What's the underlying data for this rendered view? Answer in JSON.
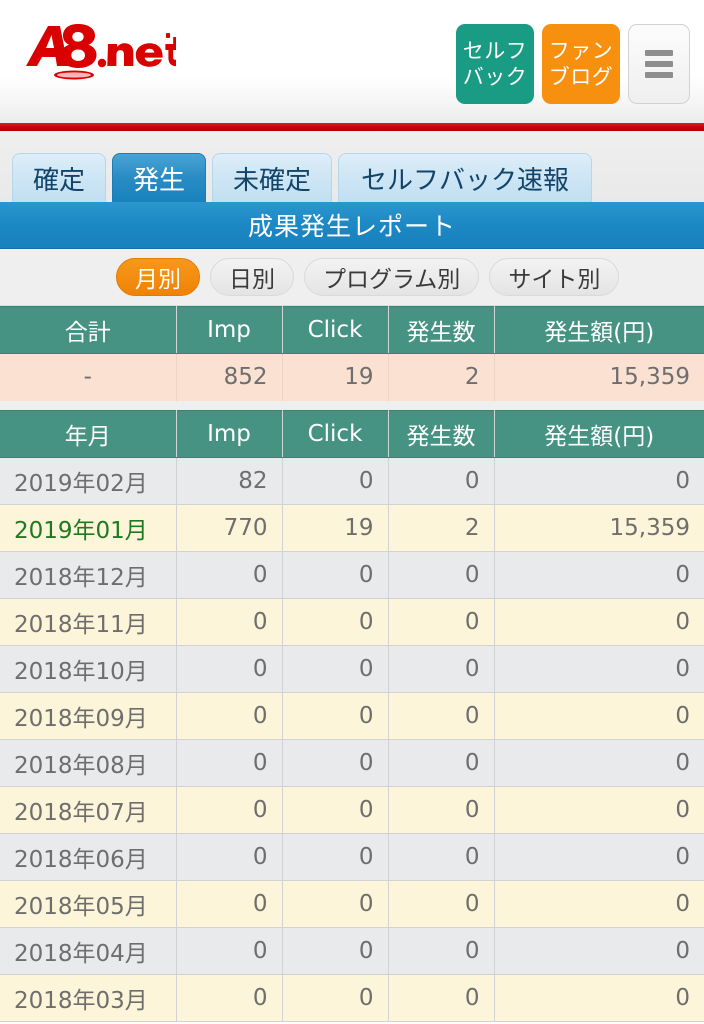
{
  "header": {
    "logo_text": "A8.net",
    "logo_alt": "a8net-logo",
    "buttons": [
      {
        "name": "selfback-button",
        "label": "セルフ\nバック",
        "line1": "セルフ",
        "line2": "バック",
        "color": "#1a9b84"
      },
      {
        "name": "fanblog-button",
        "label": "ファン\nブログ",
        "line1": "ファン",
        "line2": "ブログ",
        "color": "#f7900f"
      }
    ],
    "menu_label": "メニュー"
  },
  "tabs": [
    {
      "label": "確定",
      "active": false
    },
    {
      "label": "発生",
      "active": true
    },
    {
      "label": "未確定",
      "active": false
    },
    {
      "label": "セルフバック速報",
      "active": false
    }
  ],
  "banner": {
    "title": "成果発生レポート"
  },
  "pills": [
    {
      "label": "月別",
      "active": true
    },
    {
      "label": "日別",
      "active": false
    },
    {
      "label": "プログラム別",
      "active": false
    },
    {
      "label": "サイト別",
      "active": false
    }
  ],
  "summary_table": {
    "headers": [
      "合計",
      "Imp",
      "Click",
      "発生数",
      "発生額(円)"
    ],
    "row": [
      "-",
      "852",
      "19",
      "2",
      "15,359"
    ]
  },
  "detail_table": {
    "headers": [
      "年月",
      "Imp",
      "Click",
      "発生数",
      "発生額(円)"
    ],
    "rows": [
      {
        "label": "2019年02月",
        "imp": "82",
        "click": "0",
        "count": "0",
        "amount": "0",
        "link": false
      },
      {
        "label": "2019年01月",
        "imp": "770",
        "click": "19",
        "count": "2",
        "amount": "15,359",
        "link": true
      },
      {
        "label": "2018年12月",
        "imp": "0",
        "click": "0",
        "count": "0",
        "amount": "0",
        "link": false
      },
      {
        "label": "2018年11月",
        "imp": "0",
        "click": "0",
        "count": "0",
        "amount": "0",
        "link": false
      },
      {
        "label": "2018年10月",
        "imp": "0",
        "click": "0",
        "count": "0",
        "amount": "0",
        "link": false
      },
      {
        "label": "2018年09月",
        "imp": "0",
        "click": "0",
        "count": "0",
        "amount": "0",
        "link": false
      },
      {
        "label": "2018年08月",
        "imp": "0",
        "click": "0",
        "count": "0",
        "amount": "0",
        "link": false
      },
      {
        "label": "2018年07月",
        "imp": "0",
        "click": "0",
        "count": "0",
        "amount": "0",
        "link": false
      },
      {
        "label": "2018年06月",
        "imp": "0",
        "click": "0",
        "count": "0",
        "amount": "0",
        "link": false
      },
      {
        "label": "2018年05月",
        "imp": "0",
        "click": "0",
        "count": "0",
        "amount": "0",
        "link": false
      },
      {
        "label": "2018年04月",
        "imp": "0",
        "click": "0",
        "count": "0",
        "amount": "0",
        "link": false
      },
      {
        "label": "2018年03月",
        "imp": "0",
        "click": "0",
        "count": "0",
        "amount": "0",
        "link": false
      }
    ]
  },
  "colors": {
    "brand_red": "#cc0000",
    "accent_blue": "#1880bd",
    "accent_orange": "#f8981d",
    "accent_teal": "#1a9b84",
    "table_header_green": "#469384",
    "summary_row_peach": "#fae1d2",
    "row_gray": "#e9eaec",
    "row_cream": "#fdf5d9",
    "link_green": "#1f7a1f"
  }
}
